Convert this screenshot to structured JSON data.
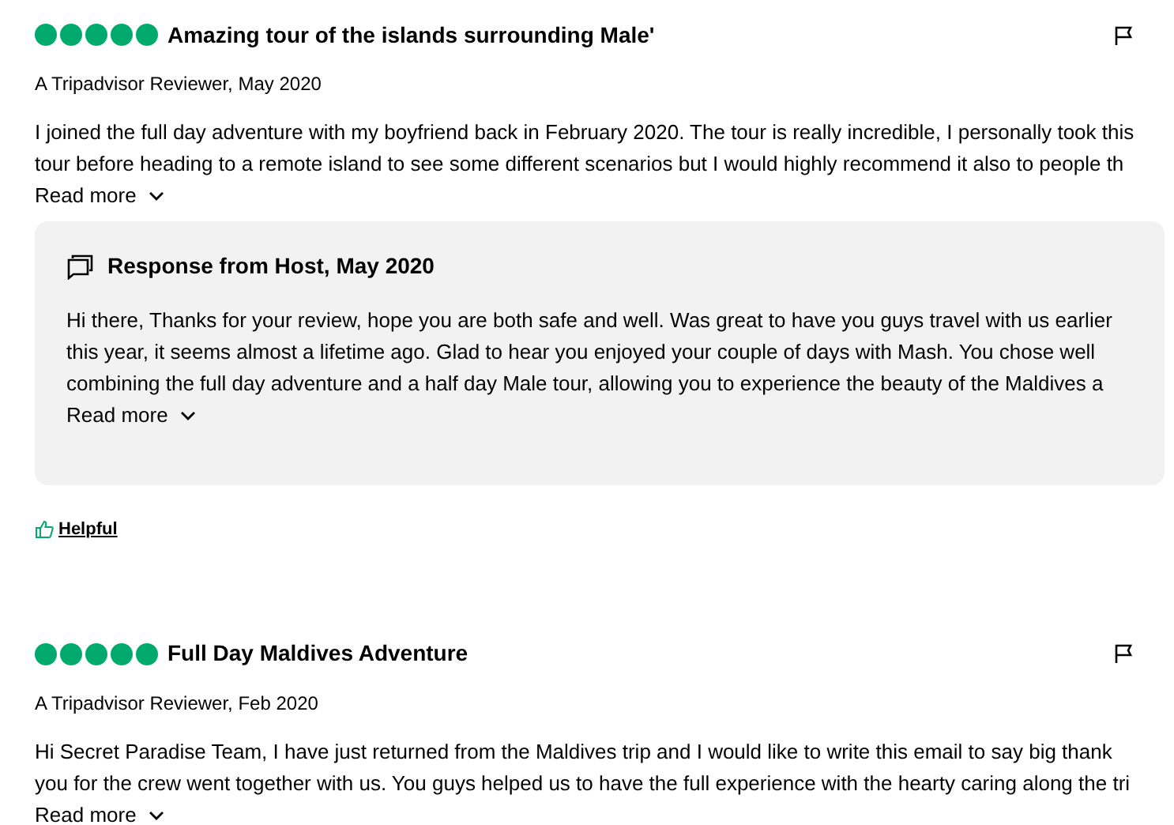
{
  "reviews": [
    {
      "stars": 5,
      "title": "Amazing tour of the islands surrounding Male'",
      "byline": "A Tripadvisor Reviewer, May 2020",
      "lines": [
        "I joined the full day adventure with my boyfriend back in February 2020. The tour is really incredible, I personally took this",
        "tour before heading to a remote island to see some different scenarios but I would highly recommend it also to people th"
      ],
      "read_more": "Read more",
      "response": {
        "title": "Response from Host, May 2020",
        "lines": [
          "Hi there, Thanks for your review, hope you are both safe and well. Was great to have you guys travel with us earlier",
          "this year, it seems almost a lifetime ago. Glad to hear you enjoyed your couple of days with Mash. You chose well",
          "combining the full day adventure and a half day Male tour, allowing you to experience the beauty of the Maldives a"
        ],
        "read_more": "Read more"
      },
      "helpful": "Helpful"
    },
    {
      "stars": 5,
      "title": "Full Day Maldives Adventure",
      "byline": "A Tripadvisor Reviewer, Feb 2020",
      "lines": [
        "Hi Secret Paradise Team, I have just returned from the Maldives trip and I would like to write this email to say big thank",
        "you for the crew went together with us. You guys helped us to have the full experience with the hearty caring along the tri"
      ],
      "read_more": "Read more"
    }
  ]
}
